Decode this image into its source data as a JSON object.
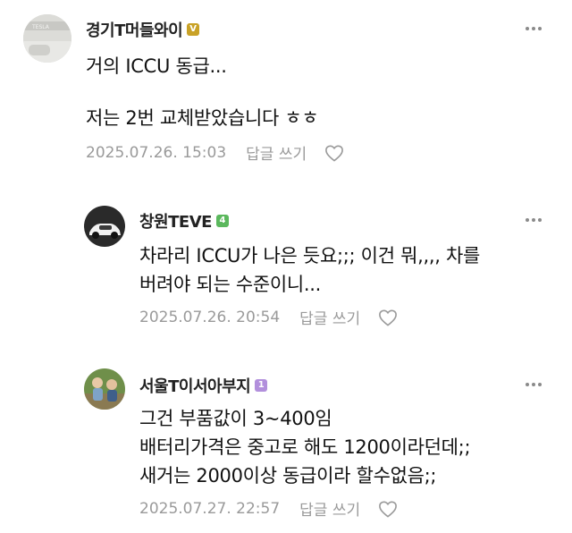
{
  "comments": [
    {
      "author": "경기T머들와이",
      "badge": "V",
      "badge_color": "#c9a227",
      "lines": [
        "거의 ICCU 동급...",
        "저는 2번 교체받았습니다 ㅎㅎ"
      ],
      "date": "2025.07.26. 15:03",
      "reply_label": "답글 쓰기",
      "avatar_icon": "tesla-car-photo-avatar"
    },
    {
      "author": "창원TEVE",
      "badge": "4",
      "badge_color": "#5bb85d",
      "lines": [
        "차라리 ICCU가 나은 듯요;;; 이건 뭐,,,, 차를",
        "버려야 되는 수준이니..."
      ],
      "date": "2025.07.26. 20:54",
      "reply_label": "답글 쓰기",
      "avatar_icon": "white-car-photo-avatar"
    },
    {
      "author": "서울T이서아부지",
      "badge": "1",
      "badge_color": "#b28fdc",
      "lines": [
        "그건 부품값이 3~400임",
        "배터리가격은 중고로 해도 1200이라던데;;",
        "새거는 2000이상 동급이라 할수없음;;"
      ],
      "date": "2025.07.27. 22:57",
      "reply_label": "답글 쓰기",
      "avatar_icon": "children-photo-avatar"
    }
  ]
}
